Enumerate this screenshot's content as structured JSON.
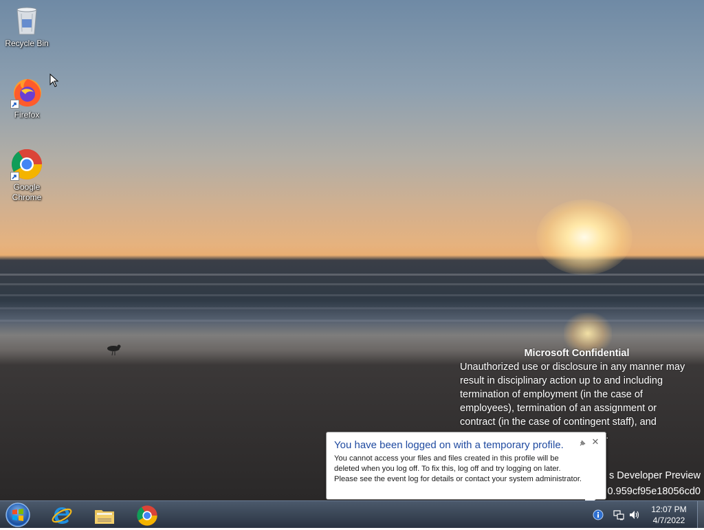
{
  "desktop_icons": [
    {
      "label": "Recycle Bin",
      "icon": "recycle-bin-icon"
    },
    {
      "label": "Firefox",
      "icon": "firefox-icon"
    },
    {
      "label": "Google Chrome",
      "icon": "chrome-icon"
    }
  ],
  "watermark": {
    "title": "Microsoft Confidential",
    "lines": [
      "Unauthorized use or disclosure in any manner may",
      "result in disciplinary action up to and including",
      "termination of employment (in the case of",
      "employees), termination of an assignment or",
      "contract (in the case of contingent staff), and",
      "ty."
    ],
    "build_line1": "s Developer Preview",
    "build_line2": "0.959cf95e18056cd0"
  },
  "notification": {
    "title": "You have been logged on with a temporary profile.",
    "body_lines": [
      "You cannot access your files and files created in this profile will be",
      "deleted when you log off. To fix this, log off and try logging on later.",
      "Please see the event log for details or contact your system administrator."
    ],
    "pin_icon": "pin-icon",
    "close_icon": "close-icon",
    "close_glyph": "✕"
  },
  "taskbar": {
    "start_icon": "windows-logo-icon",
    "pinned": [
      {
        "name": "Internet Explorer",
        "icon": "internet-explorer-icon"
      },
      {
        "name": "Windows Explorer",
        "icon": "folder-icon"
      },
      {
        "name": "Google Chrome",
        "icon": "chrome-icon"
      }
    ],
    "tray": [
      {
        "icon": "action-center-icon"
      },
      {
        "icon": "network-icon"
      },
      {
        "icon": "volume-icon"
      }
    ],
    "time": "12:07 PM",
    "date": "4/7/2022"
  }
}
